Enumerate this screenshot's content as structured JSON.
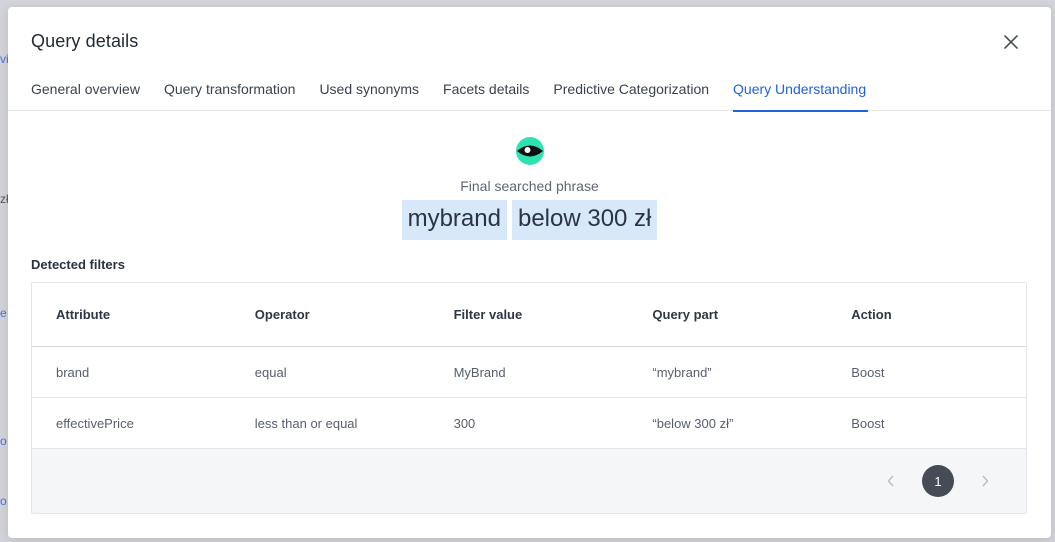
{
  "modal": {
    "title": "Query details",
    "tabs": [
      {
        "label": "General overview"
      },
      {
        "label": "Query transformation"
      },
      {
        "label": "Used synonyms"
      },
      {
        "label": "Facets details"
      },
      {
        "label": "Predictive Categorization"
      },
      {
        "label": "Query Understanding",
        "active": true
      }
    ]
  },
  "hero": {
    "icon": "eye-icon",
    "label": "Final searched phrase",
    "phrase_parts": [
      "mybrand",
      "below 300 zł"
    ]
  },
  "filters": {
    "title": "Detected filters",
    "columns": [
      "Attribute",
      "Operator",
      "Filter value",
      "Query part",
      "Action"
    ],
    "rows": [
      [
        "brand",
        "equal",
        "MyBrand",
        "“mybrand”",
        "Boost"
      ],
      [
        "effectivePrice",
        "less than or equal",
        "300",
        "“below 300 zł”",
        "Boost"
      ]
    ]
  },
  "pagination": {
    "current_page": "1"
  },
  "colors": {
    "accent": "#1f62e0",
    "chip_bg": "#d7e8fb",
    "eye_green": "#2fe3b0",
    "pager_active": "#464c56"
  }
}
